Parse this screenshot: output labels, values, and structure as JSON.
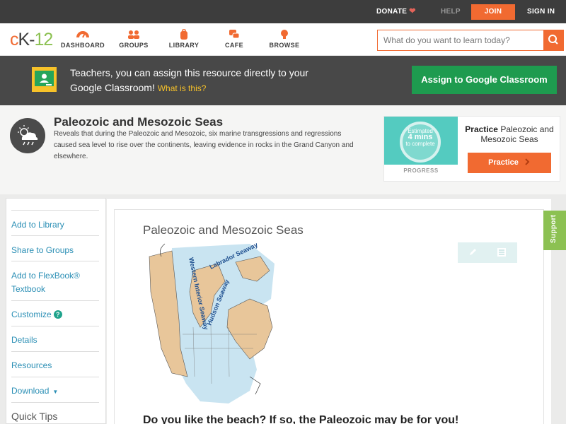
{
  "topbar": {
    "donate": "DONATE",
    "help": "HELP",
    "join": "JOIN",
    "signin": "SIGN IN"
  },
  "header": {
    "logo": {
      "c": "c",
      "k": "K-",
      "n": "12"
    },
    "nav": [
      {
        "label": "DASHBOARD",
        "icon": "gauge-icon"
      },
      {
        "label": "GROUPS",
        "icon": "people-icon"
      },
      {
        "label": "LIBRARY",
        "icon": "backpack-icon"
      },
      {
        "label": "CAFE",
        "icon": "chat-bubbles-icon"
      },
      {
        "label": "BROWSE",
        "icon": "lightbulb-icon"
      }
    ],
    "search_placeholder": "What do you want to learn today?"
  },
  "banner": {
    "text": "Teachers, you can assign this resource directly to your Google Classroom!",
    "what": "What is this?",
    "assign": "Assign to Google Classroom"
  },
  "concept": {
    "title": "Paleozoic and Mesozoic Seas",
    "description": "Reveals that during the Paleozoic and Mesozoic, six marine transgressions and regressions caused sea level to rise over the continents, leaving evidence in rocks in the Grand Canyon and elsewhere.",
    "practice": {
      "estimated": "Estimated",
      "mins": "4 mins",
      "to_complete": "to complete",
      "progress_label": "PROGRESS",
      "practice_word": "Practice",
      "practice_title": "Paleozoic and Mesozoic Seas",
      "button": "Practice"
    }
  },
  "sidebar": {
    "items": [
      {
        "label": "Add to Library"
      },
      {
        "label": "Share to Groups"
      },
      {
        "label": "Add to FlexBook® Textbook"
      },
      {
        "label": "Customize"
      },
      {
        "label": "Details"
      },
      {
        "label": "Resources"
      },
      {
        "label": "Download"
      }
    ],
    "customize_badge": "?",
    "quick_tips": "Quick Tips"
  },
  "content": {
    "title": "Paleozoic and Mesozoic Seas",
    "map_labels": {
      "western": "Western Interior Seaway",
      "labrador": "Labrador Seaway",
      "hudson": "Hudson Seaway"
    },
    "teaser": "Do you like the beach? If so, the Paleozoic may be for you!"
  },
  "support": "Support",
  "colors": {
    "accent": "#f16a31",
    "assign_green": "#1e9b4f",
    "link_blue": "#2b8fb5",
    "support_green": "#8cc152",
    "practice_teal": "#54cbc0"
  }
}
